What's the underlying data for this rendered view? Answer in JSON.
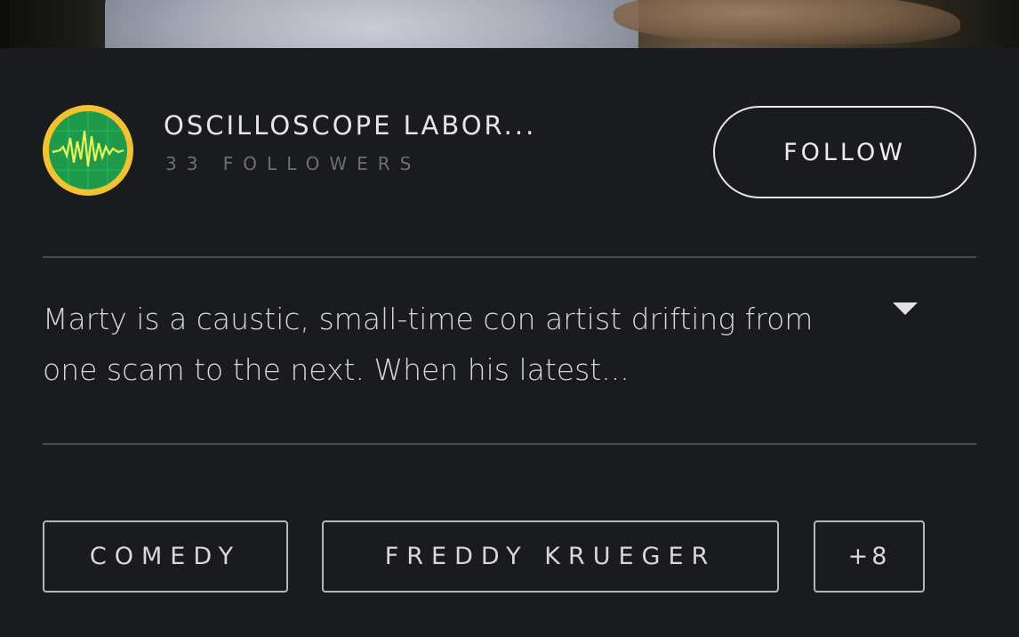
{
  "creator": {
    "name": "OSCILLOSCOPE LABOR...",
    "followers": "33 FOLLOWERS",
    "avatar_icon": "oscilloscope-logo-icon",
    "avatar_colors": {
      "ring": "#f2c230",
      "screen": "#1f9a4a"
    }
  },
  "follow_button": {
    "label": "FOLLOW"
  },
  "description": {
    "text": "Marty is a caustic, small-time con artist drifting from one scam to the next. When his latest...",
    "toggle_icon": "caret-down-icon"
  },
  "tags": [
    {
      "label": "COMEDY"
    },
    {
      "label": "FREDDY KRUEGER"
    },
    {
      "label": "+8"
    }
  ]
}
